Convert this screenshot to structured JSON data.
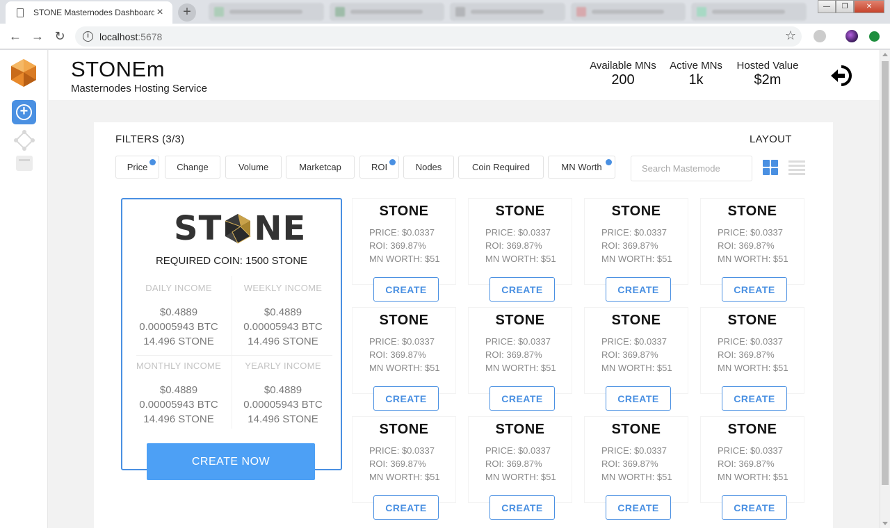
{
  "browser": {
    "tab_title": "STONE Masternodes Dashboard",
    "tab_close": "×",
    "new_tab": "+",
    "url_host": "localhost",
    "url_port": ":5678"
  },
  "header": {
    "brand": "STONEm",
    "subtitle": "Masternodes Hosting Service",
    "stats": [
      {
        "label": "Available MNs",
        "value": "200"
      },
      {
        "label": "Active MNs",
        "value": "1k"
      },
      {
        "label": "Hosted Value",
        "value": "$2m"
      }
    ]
  },
  "filters": {
    "title": "FILTERS (3/3)",
    "layout_title": "LAYOUT",
    "chips": [
      {
        "label": "Price",
        "active": true
      },
      {
        "label": "Change",
        "active": false
      },
      {
        "label": "Volume",
        "active": false
      },
      {
        "label": "Marketcap",
        "active": false
      },
      {
        "label": "ROI",
        "active": true
      },
      {
        "label": "Nodes",
        "active": false
      },
      {
        "label": "Coin Required",
        "active": false
      },
      {
        "label": "MN Worth",
        "active": true
      }
    ],
    "search_placeholder": "Search Mastemode"
  },
  "featured": {
    "logo_text_left": "ST",
    "logo_text_right": "NE",
    "required": "REQUIRED COIN: 1500 STONE",
    "incomes": [
      {
        "title": "DAILY INCOME",
        "usd": "$0.4889",
        "btc": "0.00005943 BTC",
        "coin": "14.496 STONE"
      },
      {
        "title": "WEEKLY INCOME",
        "usd": "$0.4889",
        "btc": "0.00005943 BTC",
        "coin": "14.496 STONE"
      },
      {
        "title": "MONTHLY INCOME",
        "usd": "$0.4889",
        "btc": "0.00005943 BTC",
        "coin": "14.496 STONE"
      },
      {
        "title": "YEARLY INCOME",
        "usd": "$0.4889",
        "btc": "0.00005943 BTC",
        "coin": "14.496 STONE"
      }
    ],
    "cta": "CREATE NOW"
  },
  "cards": [
    {
      "name": "STONE",
      "price": "PRICE: $0.0337",
      "roi": "ROI: 369.87%",
      "worth": "MN WORTH: $51",
      "button": "CREATE"
    },
    {
      "name": "STONE",
      "price": "PRICE: $0.0337",
      "roi": "ROI: 369.87%",
      "worth": "MN WORTH: $51",
      "button": "CREATE"
    },
    {
      "name": "STONE",
      "price": "PRICE: $0.0337",
      "roi": "ROI: 369.87%",
      "worth": "MN WORTH: $51",
      "button": "CREATE"
    },
    {
      "name": "STONE",
      "price": "PRICE: $0.0337",
      "roi": "ROI: 369.87%",
      "worth": "MN WORTH: $51",
      "button": "CREATE"
    },
    {
      "name": "STONE",
      "price": "PRICE: $0.0337",
      "roi": "ROI: 369.87%",
      "worth": "MN WORTH: $51",
      "button": "CREATE"
    },
    {
      "name": "STONE",
      "price": "PRICE: $0.0337",
      "roi": "ROI: 369.87%",
      "worth": "MN WORTH: $51",
      "button": "CREATE"
    },
    {
      "name": "STONE",
      "price": "PRICE: $0.0337",
      "roi": "ROI: 369.87%",
      "worth": "MN WORTH: $51",
      "button": "CREATE"
    },
    {
      "name": "STONE",
      "price": "PRICE: $0.0337",
      "roi": "ROI: 369.87%",
      "worth": "MN WORTH: $51",
      "button": "CREATE"
    },
    {
      "name": "STONE",
      "price": "PRICE: $0.0337",
      "roi": "ROI: 369.87%",
      "worth": "MN WORTH: $51",
      "button": "CREATE"
    },
    {
      "name": "STONE",
      "price": "PRICE: $0.0337",
      "roi": "ROI: 369.87%",
      "worth": "MN WORTH: $51",
      "button": "CREATE"
    },
    {
      "name": "STONE",
      "price": "PRICE: $0.0337",
      "roi": "ROI: 369.87%",
      "worth": "MN WORTH: $51",
      "button": "CREATE"
    },
    {
      "name": "STONE",
      "price": "PRICE: $0.0337",
      "roi": "ROI: 369.87%",
      "worth": "MN WORTH: $51",
      "button": "CREATE"
    }
  ],
  "colors": {
    "accent": "#4a90e2",
    "cta": "#4da0f5",
    "logo_orange": "#e8892b"
  },
  "icons": [
    "document-icon",
    "info-icon",
    "star-icon",
    "logo-hex-icon",
    "add-circle-icon",
    "nodes-icon",
    "card-icon",
    "logout-icon",
    "grid-layout-icon",
    "list-layout-icon"
  ]
}
